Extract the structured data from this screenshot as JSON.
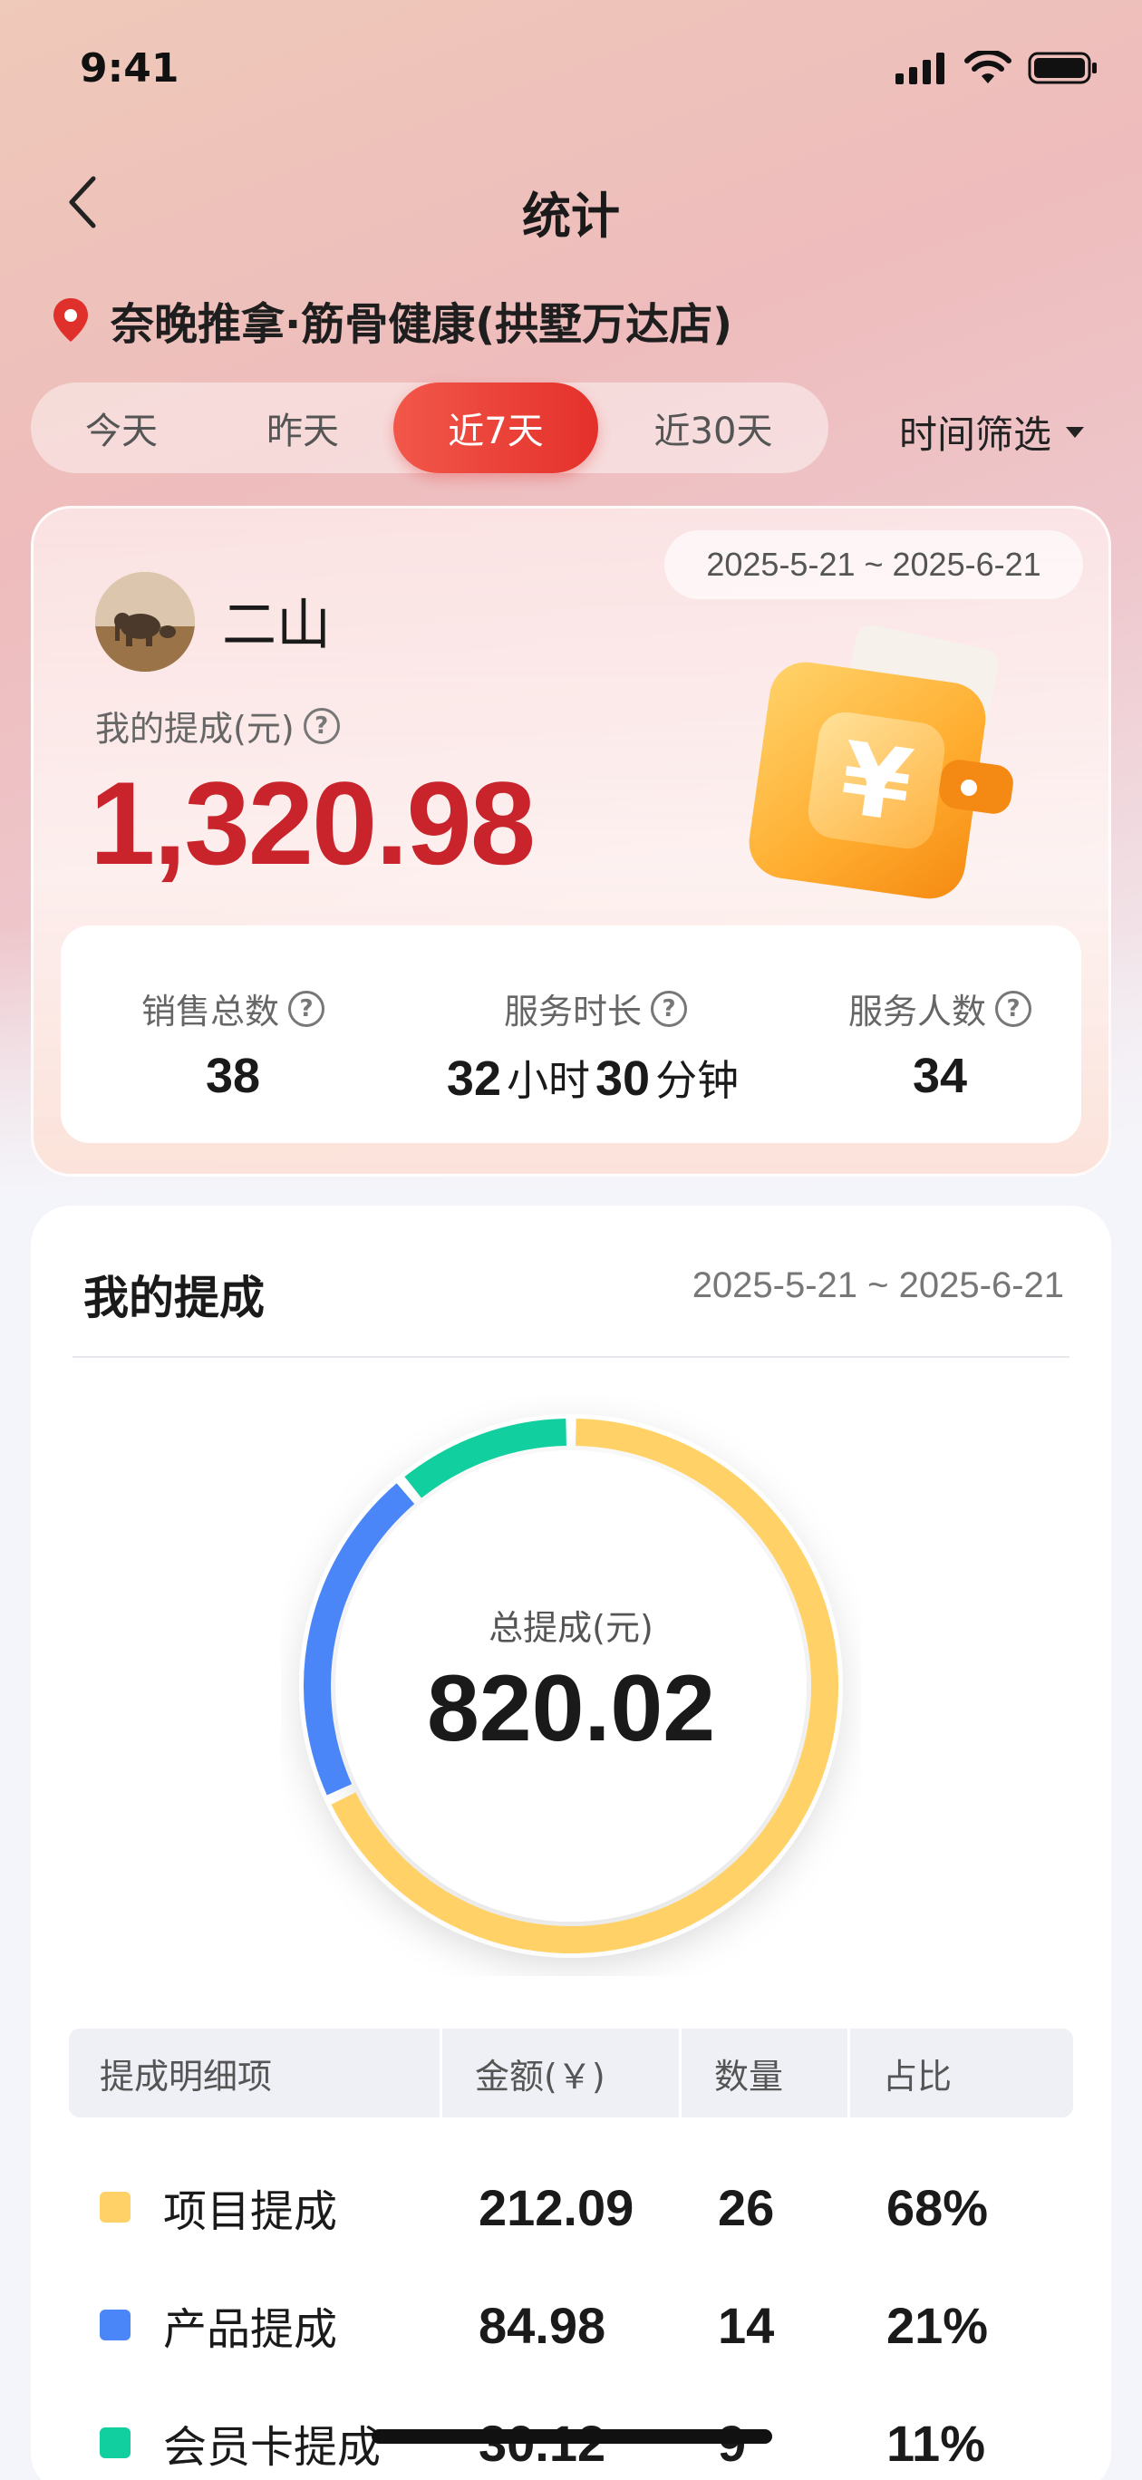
{
  "status_bar": {
    "time": "9:41"
  },
  "nav": {
    "title": "统计"
  },
  "store": {
    "name": "奈晚推拿·筋骨健康(拱墅万达店)"
  },
  "tabs": [
    {
      "label": "今天",
      "active": false
    },
    {
      "label": "昨天",
      "active": false
    },
    {
      "label": "近7天",
      "active": true
    },
    {
      "label": "近30天",
      "active": false
    }
  ],
  "time_filter": {
    "label": "时间筛选"
  },
  "summary": {
    "date_range": "2025-5-21 ~ 2025-6-21",
    "user_name": "二山",
    "commission_label": "我的提成(元)",
    "commission_value": "1,320.98",
    "stats": {
      "sales_label": "销售总数",
      "sales_value": "38",
      "duration_label": "服务时长",
      "duration_hours": "32",
      "duration_hours_unit": "小时",
      "duration_minutes": "30",
      "duration_minutes_unit": "分钟",
      "people_label": "服务人数",
      "people_value": "34"
    }
  },
  "detail": {
    "title": "我的提成",
    "date_range": "2025-5-21 ~ 2025-6-21",
    "total_label": "总提成(元)",
    "total_value": "820.02",
    "table_headers": [
      "提成明细项",
      "金额(￥)",
      "数量",
      "占比"
    ],
    "rows": [
      {
        "name": "项目提成",
        "amount": "212.09",
        "count": "26",
        "share": "68%",
        "color": "#ffd166"
      },
      {
        "name": "产品提成",
        "amount": "84.98",
        "count": "14",
        "share": "21%",
        "color": "#4a86f7"
      },
      {
        "name": "会员卡提成",
        "amount": "30.12",
        "count": "9",
        "share": "11%",
        "color": "#12cfa0"
      }
    ]
  },
  "chart_data": {
    "type": "pie",
    "categories": [
      "项目提成",
      "产品提成",
      "会员卡提成"
    ],
    "values": [
      68,
      21,
      11
    ],
    "colors": [
      "#ffd166",
      "#4a86f7",
      "#12cfa0"
    ]
  }
}
